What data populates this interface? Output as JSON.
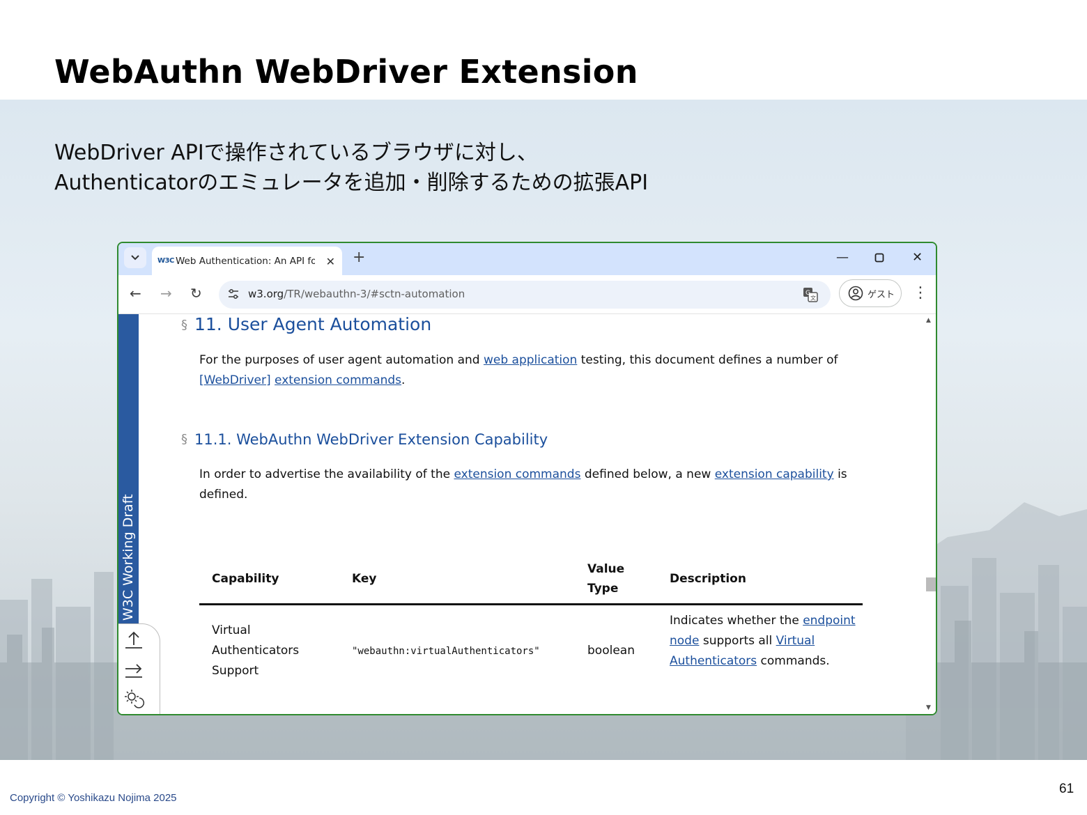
{
  "slide": {
    "title": "WebAuthn WebDriver Extension",
    "subtitle_line1": "WebDriver APIで操作されているブラウザに対し、",
    "subtitle_line2": "Authenticatorのエミュレータを追加・削除するための拡張API",
    "copyright": "Copyright © Yoshikazu Nojima 2025",
    "page_number": "61"
  },
  "browser": {
    "tab_title": "Web Authentication: An API for",
    "favicon_text": "W3C",
    "url_host": "w3.org",
    "url_path": "/TR/webauthn-3/#sctn-automation",
    "profile_label": "ゲスト"
  },
  "doc": {
    "rail_label": "W3C Working Draft",
    "section_mark": "§",
    "h2": "11. User Agent Automation",
    "p1": {
      "t1": "For the purposes of user agent automation and ",
      "l1": "web application",
      "t2": " testing, this document defines a number of ",
      "l2": "[WebDriver]",
      "t3": " ",
      "l3": "extension commands",
      "t4": "."
    },
    "h3": "11.1. WebAuthn WebDriver Extension Capability",
    "p2": {
      "t1": "In order to advertise the availability of the ",
      "l1": "extension commands",
      "t2": " defined below, a new ",
      "l2": "extension capability",
      "t3": " is defined."
    },
    "table": {
      "headers": [
        "Capability",
        "Key",
        "Value Type",
        "Description"
      ],
      "row": {
        "capability": "Virtual Authenticators Support",
        "key": "\"webauthn:virtualAuthenticators\"",
        "value_type": "boolean",
        "desc_t1": "Indicates whether the ",
        "desc_l1": "endpoint node",
        "desc_t2": " supports all ",
        "desc_l2": "Virtual Authenticators",
        "desc_t3": " commands."
      }
    }
  }
}
